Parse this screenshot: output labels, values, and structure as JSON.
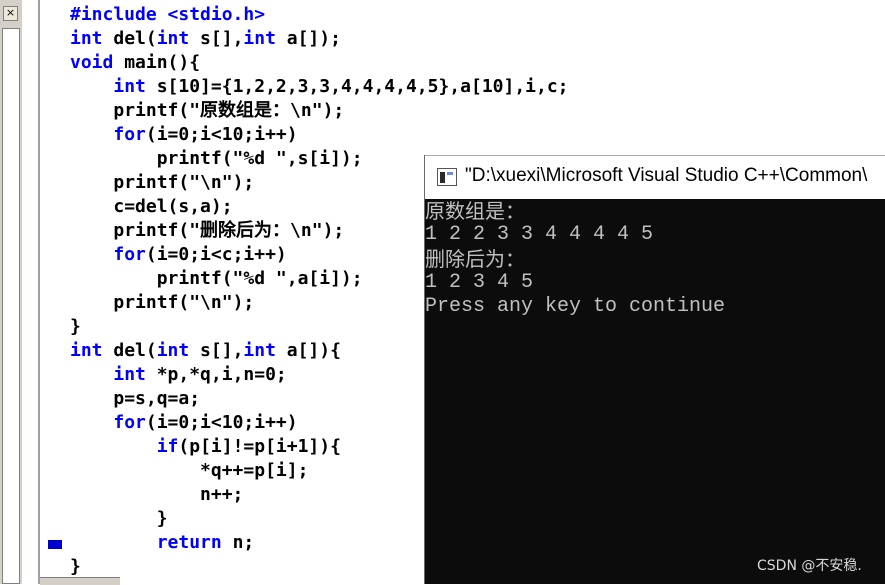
{
  "editor": {
    "close_label": "×",
    "code_lines": [
      {
        "indent": "",
        "parts": [
          {
            "t": "#include <stdio.h>",
            "k": "kw"
          }
        ]
      },
      {
        "indent": "",
        "parts": [
          {
            "t": "int",
            "k": "kw"
          },
          {
            "t": " del(",
            "k": ""
          },
          {
            "t": "int",
            "k": "kw"
          },
          {
            "t": " s[],",
            "k": ""
          },
          {
            "t": "int",
            "k": "kw"
          },
          {
            "t": " a[]);",
            "k": ""
          }
        ]
      },
      {
        "indent": "",
        "parts": [
          {
            "t": "void",
            "k": "kw"
          },
          {
            "t": " main(){",
            "k": ""
          }
        ]
      },
      {
        "indent": "    ",
        "parts": [
          {
            "t": "int",
            "k": "kw"
          },
          {
            "t": " s[10]={1,2,2,3,3,4,4,4,4,5},a[10],i,c;",
            "k": ""
          }
        ]
      },
      {
        "indent": "    ",
        "parts": [
          {
            "t": "printf(\"原数组是：\\n\");",
            "k": ""
          }
        ]
      },
      {
        "indent": "    ",
        "parts": [
          {
            "t": "for",
            "k": "kw"
          },
          {
            "t": "(i=0;i<10;i++)",
            "k": ""
          }
        ]
      },
      {
        "indent": "        ",
        "parts": [
          {
            "t": "printf(\"%d \",s[i]);",
            "k": ""
          }
        ]
      },
      {
        "indent": "    ",
        "parts": [
          {
            "t": "printf(\"\\n\");",
            "k": ""
          }
        ]
      },
      {
        "indent": "    ",
        "parts": [
          {
            "t": "c=del(s,a);",
            "k": ""
          }
        ]
      },
      {
        "indent": "    ",
        "parts": [
          {
            "t": "printf(\"删除后为：\\n\");",
            "k": ""
          }
        ]
      },
      {
        "indent": "    ",
        "parts": [
          {
            "t": "for",
            "k": "kw"
          },
          {
            "t": "(i=0;i<c;i++)",
            "k": ""
          }
        ]
      },
      {
        "indent": "        ",
        "parts": [
          {
            "t": "printf(\"%d \",a[i]);",
            "k": ""
          }
        ]
      },
      {
        "indent": "    ",
        "parts": [
          {
            "t": "printf(\"\\n\");",
            "k": ""
          }
        ]
      },
      {
        "indent": "",
        "parts": [
          {
            "t": "}",
            "k": ""
          }
        ]
      },
      {
        "indent": "",
        "parts": [
          {
            "t": "int",
            "k": "kw"
          },
          {
            "t": " del(",
            "k": ""
          },
          {
            "t": "int",
            "k": "kw"
          },
          {
            "t": " s[],",
            "k": ""
          },
          {
            "t": "int",
            "k": "kw"
          },
          {
            "t": " a[]){",
            "k": ""
          }
        ]
      },
      {
        "indent": "    ",
        "parts": [
          {
            "t": "int",
            "k": "kw"
          },
          {
            "t": " *p,*q,i,n=0;",
            "k": ""
          }
        ]
      },
      {
        "indent": "    ",
        "parts": [
          {
            "t": "p=s,q=a;",
            "k": ""
          }
        ]
      },
      {
        "indent": "    ",
        "parts": [
          {
            "t": "for",
            "k": "kw"
          },
          {
            "t": "(i=0;i<10;i++)",
            "k": ""
          }
        ]
      },
      {
        "indent": "        ",
        "parts": [
          {
            "t": "if",
            "k": "kw"
          },
          {
            "t": "(p[i]!=p[i+1]){",
            "k": ""
          }
        ]
      },
      {
        "indent": "            ",
        "parts": [
          {
            "t": "*q++=p[i];",
            "k": ""
          }
        ]
      },
      {
        "indent": "            ",
        "parts": [
          {
            "t": "n++;",
            "k": ""
          }
        ]
      },
      {
        "indent": "        ",
        "parts": [
          {
            "t": "}",
            "k": ""
          }
        ]
      },
      {
        "indent": "        ",
        "parts": [
          {
            "t": "return",
            "k": "kw"
          },
          {
            "t": " n;",
            "k": ""
          }
        ]
      },
      {
        "indent": "",
        "parts": [
          {
            "t": "}",
            "k": ""
          }
        ]
      }
    ]
  },
  "console": {
    "title": "\"D:\\xuexi\\Microsoft Visual Studio C++\\Common\\",
    "output_lines": [
      "原数组是：",
      "1 2 2 3 3 4 4 4 4 5",
      "删除后为：",
      "1 2 3 4 5",
      "Press any key to continue"
    ]
  },
  "watermark": "CSDN @不安稳.",
  "colors": {
    "keyword": "#0000ff",
    "console_bg": "#0c0c0c",
    "console_text": "#c0c0c0",
    "breakpoint_arrow": "#0000cc"
  },
  "icons": [
    "close-icon",
    "console-app-icon",
    "current-line-arrow-icon"
  ]
}
